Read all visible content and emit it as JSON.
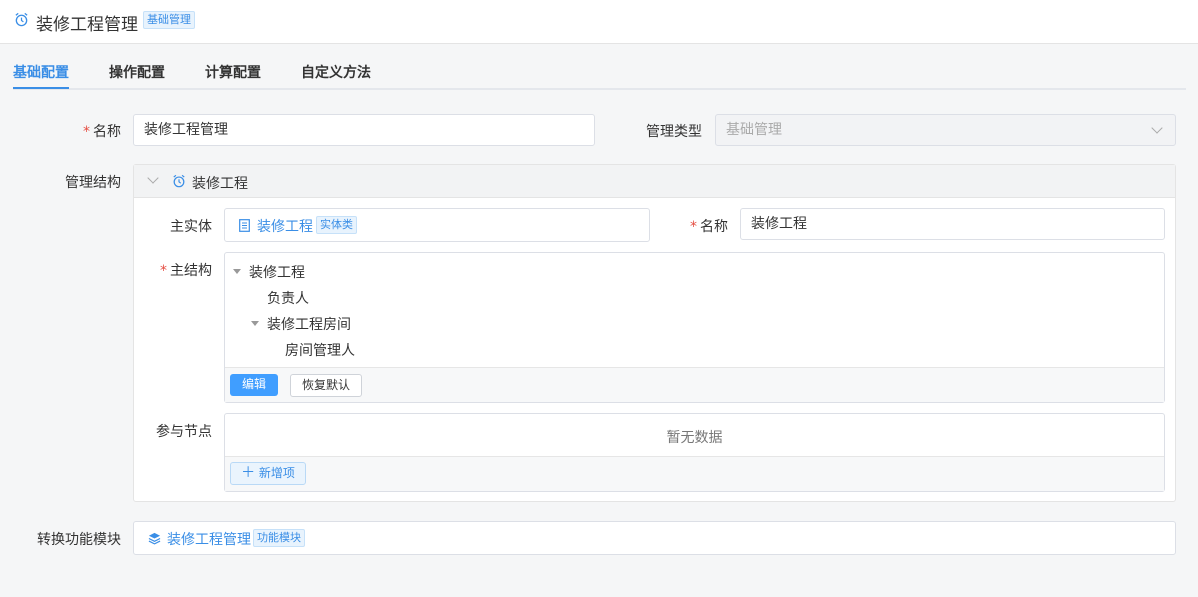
{
  "header": {
    "title": "装修工程管理",
    "tag": "基础管理",
    "icon": "alarm-clock-icon"
  },
  "tabs": [
    {
      "label": "基础配置",
      "active": true
    },
    {
      "label": "操作配置",
      "active": false
    },
    {
      "label": "计算配置",
      "active": false
    },
    {
      "label": "自定义方法",
      "active": false
    }
  ],
  "form": {
    "name_label": "名称",
    "name_value": "装修工程管理",
    "type_label": "管理类型",
    "type_value": "基础管理",
    "structure_label": "管理结构",
    "convert_label": "转换功能模块"
  },
  "structure": {
    "panel_title": "装修工程",
    "main_entity_label": "主实体",
    "main_entity_value": "装修工程",
    "main_entity_tag": "实体类",
    "name_label": "名称",
    "name_value": "装修工程",
    "main_structure_label": "主结构",
    "tree": {
      "root": "装修工程",
      "child1": "负责人",
      "child2": "装修工程房间",
      "grandchild": "房间管理人"
    },
    "edit_button": "编辑",
    "reset_button": "恢复默认",
    "nodes_label": "参与节点",
    "empty_text": "暂无数据",
    "add_button": "新增项"
  },
  "convert": {
    "value": "装修工程管理",
    "tag": "功能模块"
  },
  "colors": {
    "accent": "#3a8ee6",
    "required": "#e54d42"
  }
}
